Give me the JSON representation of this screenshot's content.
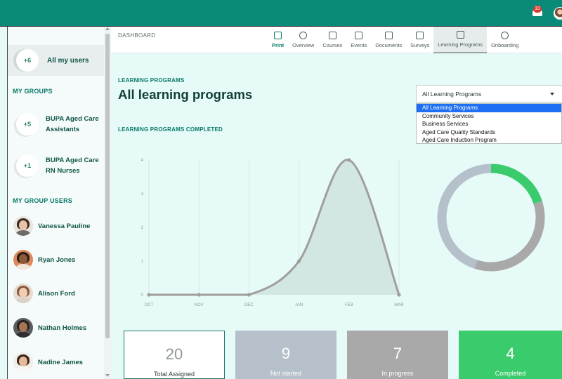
{
  "topbar": {
    "notification_count": "10",
    "brand_color": "#0a8a78"
  },
  "sidebar": {
    "all_users": {
      "count": "+6",
      "label": "All my users"
    },
    "groups_heading": "MY GROUPS",
    "groups": [
      {
        "count": "+5",
        "line1": "BUPA Aged Care",
        "line2": "Assistants"
      },
      {
        "count": "+1",
        "line1": "BUPA Aged Care",
        "line2": "RN Nurses"
      }
    ],
    "users_heading": "MY GROUP USERS",
    "users": [
      {
        "name": "Vanessa Pauline"
      },
      {
        "name": "Ryan Jones"
      },
      {
        "name": "Alison Ford"
      },
      {
        "name": "Nathan Holmes"
      },
      {
        "name": "Nadine James"
      }
    ]
  },
  "header": {
    "breadcrumb": "DASHBOARD",
    "tabs": [
      {
        "label": "Print",
        "icon": "printer-icon"
      },
      {
        "label": "Overview",
        "icon": "pie-chart-icon"
      },
      {
        "label": "Courses",
        "icon": "book-icon"
      },
      {
        "label": "Events",
        "icon": "calendar-icon"
      },
      {
        "label": "Documents",
        "icon": "document-icon"
      },
      {
        "label": "Surveys",
        "icon": "survey-icon"
      },
      {
        "label": "Learning Programs",
        "icon": "programs-icon",
        "active": true
      },
      {
        "label": "Onboarding",
        "icon": "onboarding-icon"
      }
    ]
  },
  "main": {
    "subheading": "LEARNING PROGRAMS",
    "title": "All learning programs",
    "completed_heading": "LEARNING PROGRAMS COMPLETED",
    "select": {
      "value": "All Learning Programs",
      "options": [
        "All Learning Programs",
        "Community Services",
        "Business Services",
        "Aged Care Quality Standards",
        "Aged Care Induction Program"
      ]
    }
  },
  "chart_data": [
    {
      "type": "area",
      "categories": [
        "OCT",
        "NOV",
        "DEC",
        "JAN",
        "FEB",
        "MAR"
      ],
      "values": [
        0,
        0,
        0,
        1,
        4,
        0
      ],
      "y_ticks": [
        "0",
        "1",
        "2",
        "3",
        "4"
      ],
      "ylim": [
        0,
        4
      ],
      "grid": "vertical",
      "colors": {
        "line": "#a09d9d",
        "fill": "#cfe3de"
      }
    },
    {
      "type": "pie",
      "style": "donut",
      "labels": [
        "Completed",
        "In progress",
        "Not started"
      ],
      "values": [
        4,
        7,
        9
      ],
      "colors": [
        "#3acb6c",
        "#a9a9a9",
        "#b6c0ca"
      ]
    }
  ],
  "stats": [
    {
      "value": "20",
      "label": "Total Assigned"
    },
    {
      "value": "9",
      "label": "Not started"
    },
    {
      "value": "7",
      "label": "In progress"
    },
    {
      "value": "4",
      "label": "Completed"
    }
  ]
}
